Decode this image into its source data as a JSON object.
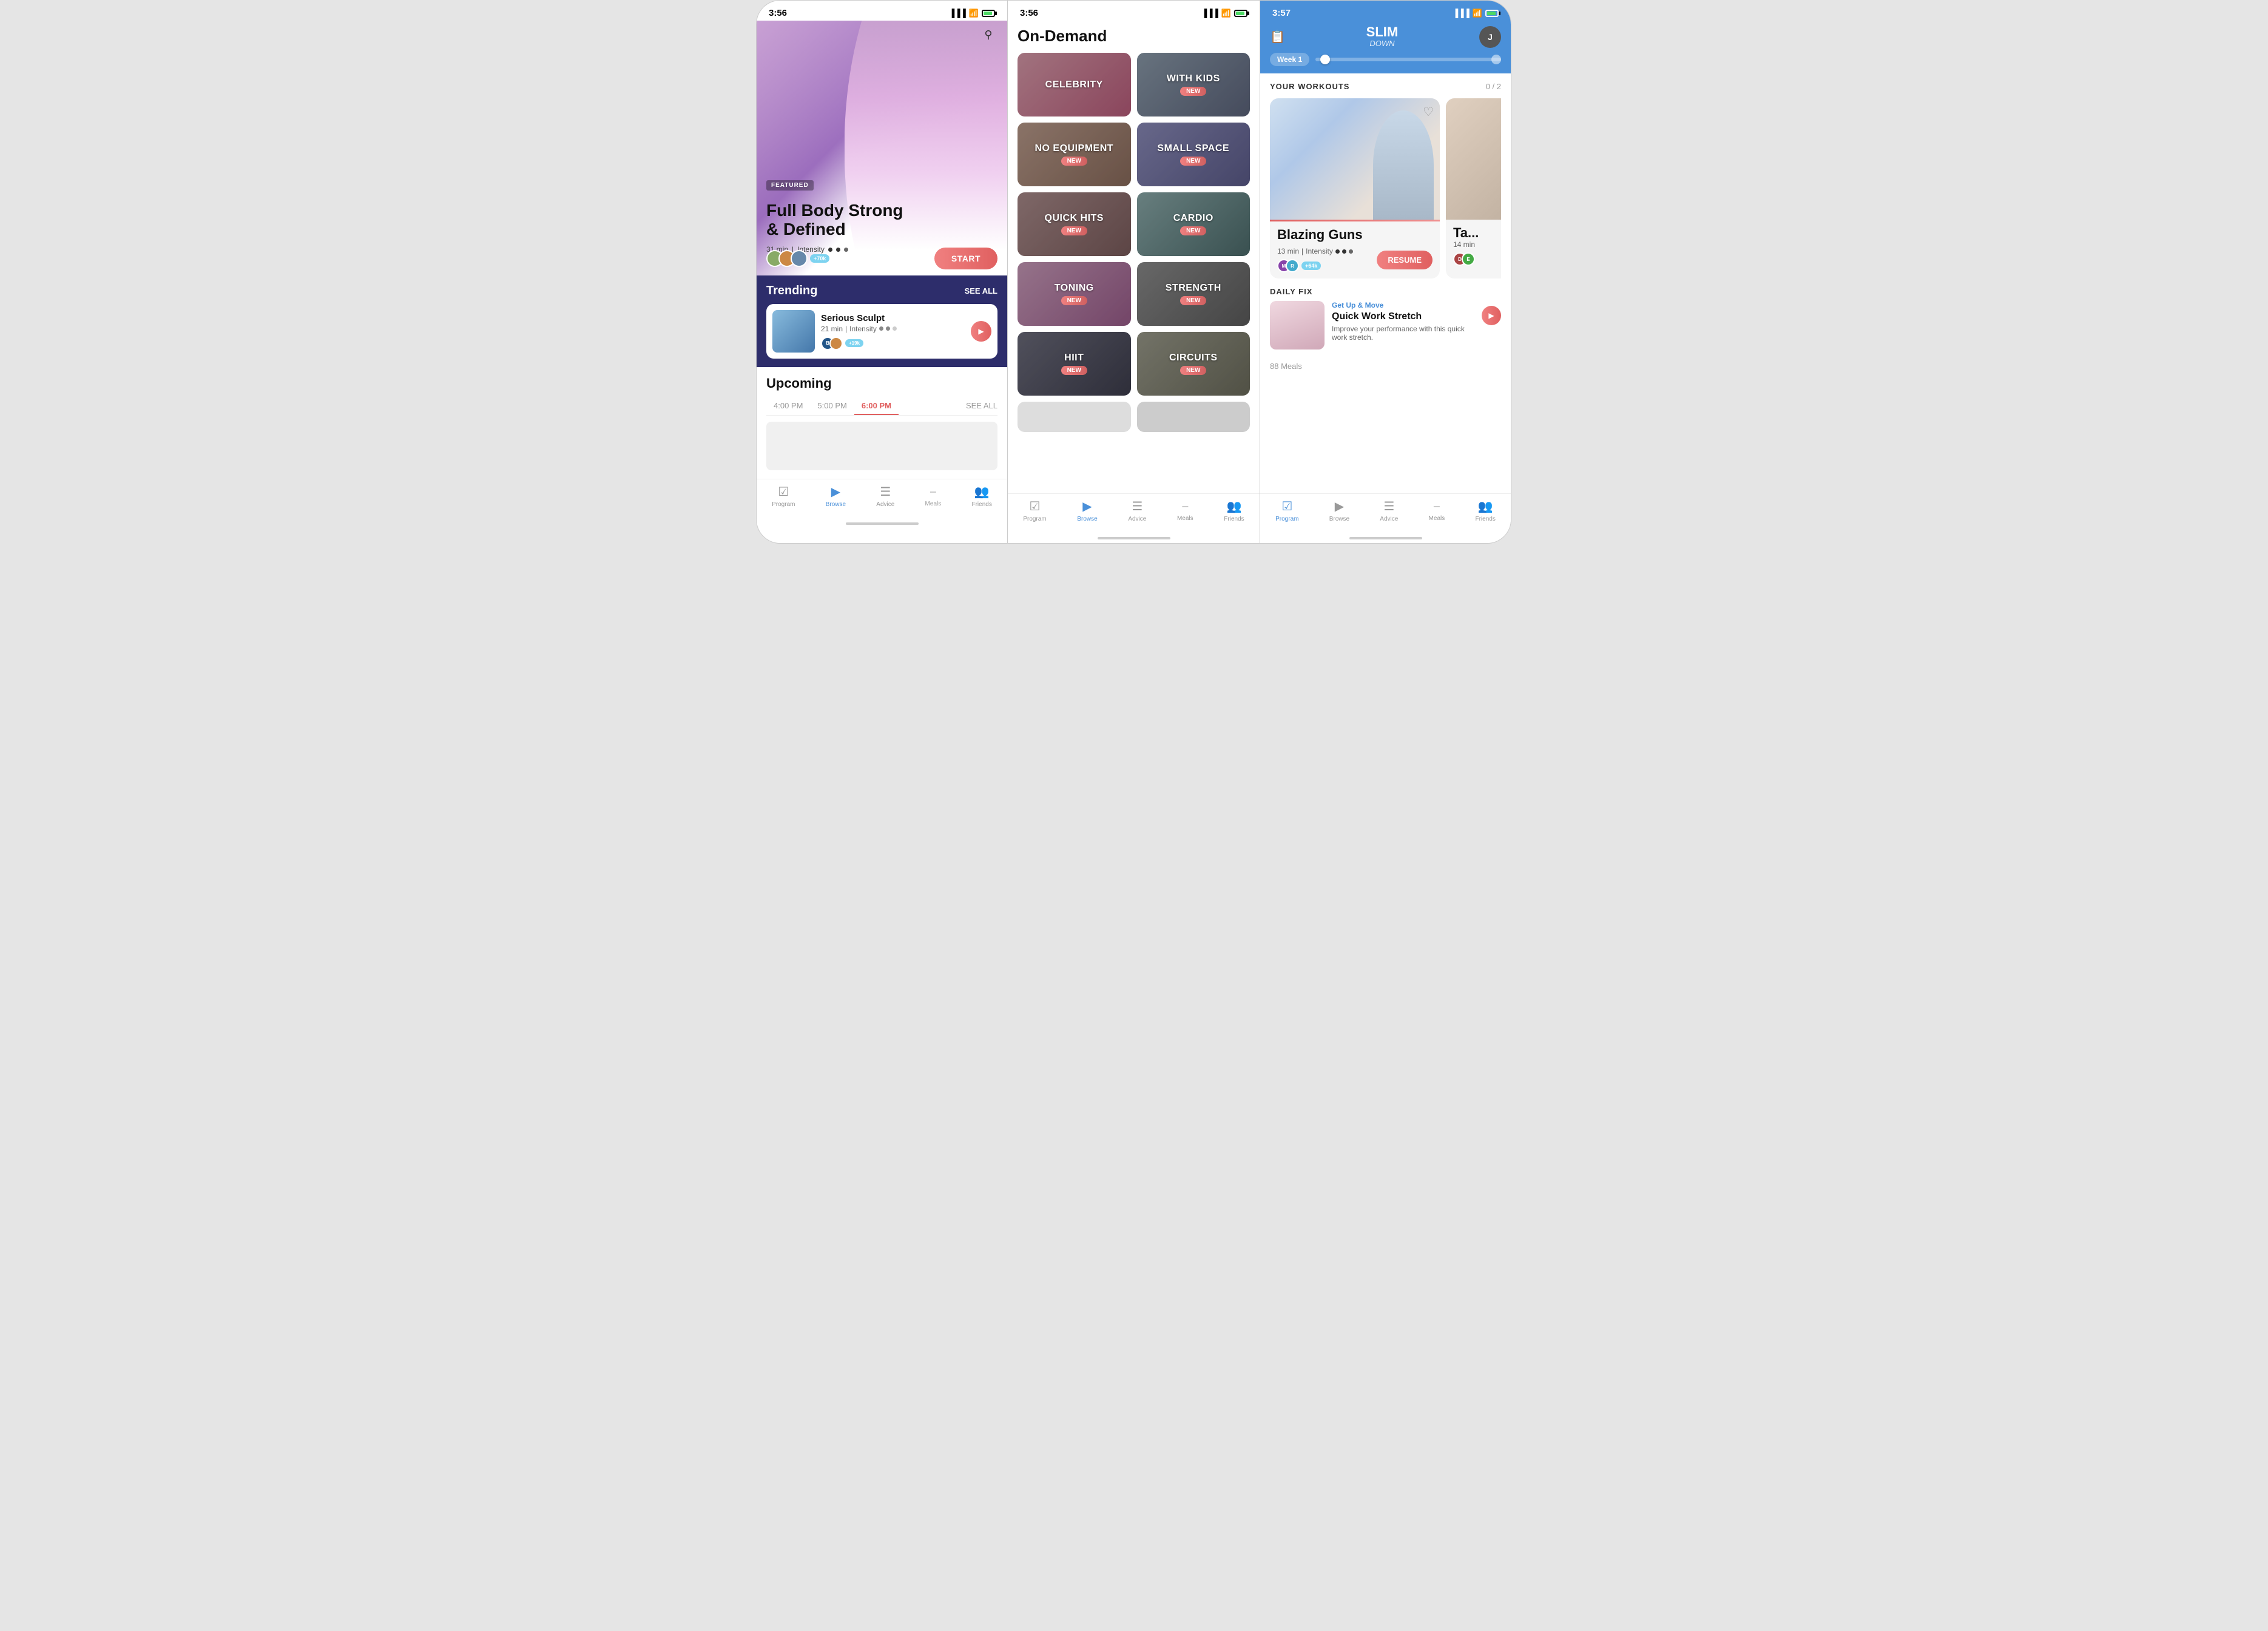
{
  "phone1": {
    "status": {
      "time": "3:56",
      "location": true
    },
    "hero": {
      "badge": "FEATURED",
      "title": "Full Body Strong\n& Defined",
      "duration": "31 min",
      "intensity_label": "Intensity",
      "user_count": "+70k",
      "start_btn": "START"
    },
    "trending": {
      "title": "Trending",
      "see_all": "SEE ALL",
      "card": {
        "name": "Serious Sculpt",
        "duration": "21 min",
        "intensity_label": "Intensity",
        "user_count": "+19k"
      }
    },
    "upcoming": {
      "title": "Upcoming",
      "times": [
        "4:00 PM",
        "5:00 PM",
        "6:00 PM"
      ],
      "active_time": "6:00 PM",
      "see_all": "SEE ALL"
    },
    "nav": [
      {
        "id": "program",
        "label": "Program",
        "icon": "☑"
      },
      {
        "id": "browse",
        "label": "Browse",
        "icon": "▷",
        "active": true
      },
      {
        "id": "advice",
        "label": "Advice",
        "icon": "☰"
      },
      {
        "id": "meals",
        "label": "Meals",
        "icon": "🍴"
      },
      {
        "id": "friends",
        "label": "Friends",
        "icon": "👥"
      }
    ]
  },
  "phone2": {
    "status": {
      "time": "3:56",
      "location": true
    },
    "title": "On-Demand",
    "categories": [
      {
        "id": "celebrity",
        "label": "CELEBRITY",
        "bg": "celebrity",
        "new": false
      },
      {
        "id": "withkids",
        "label": "WITH KIDS",
        "bg": "withkids",
        "new": true
      },
      {
        "id": "noequip",
        "label": "NO EQUIPMENT",
        "bg": "noequip",
        "new": true
      },
      {
        "id": "smallspace",
        "label": "SMALL SPACE",
        "bg": "smallspace",
        "new": true
      },
      {
        "id": "quickhits",
        "label": "QUICK HITS",
        "bg": "quickhits",
        "new": true
      },
      {
        "id": "cardio",
        "label": "CARDIO",
        "bg": "cardio",
        "new": true
      },
      {
        "id": "toning",
        "label": "TONING",
        "bg": "toning",
        "new": true
      },
      {
        "id": "strength",
        "label": "STRENGTH",
        "bg": "strength",
        "new": true
      },
      {
        "id": "hiit",
        "label": "HIIT",
        "bg": "hiit",
        "new": true
      },
      {
        "id": "circuits",
        "label": "CIRCUITS",
        "bg": "circuits",
        "new": true
      }
    ],
    "new_label": "NEW",
    "nav": [
      {
        "id": "program",
        "label": "Program",
        "icon": "☑"
      },
      {
        "id": "browse",
        "label": "Browse",
        "icon": "▷",
        "active": true
      },
      {
        "id": "advice",
        "label": "Advice",
        "icon": "☰"
      },
      {
        "id": "meals",
        "label": "Meals",
        "icon": "🍴"
      },
      {
        "id": "friends",
        "label": "Friends",
        "icon": "👥"
      }
    ]
  },
  "phone3": {
    "status": {
      "time": "3:57",
      "location": true
    },
    "header": {
      "logo_line1": "SLIM",
      "logo_line2": "DOWN",
      "week": "Week 1",
      "avatar_initial": "J"
    },
    "your_workouts": {
      "title": "YOUR WORKOUTS",
      "count": "0 / 2",
      "cards": [
        {
          "title": "Blazing Guns",
          "duration": "13 min",
          "intensity_label": "Intensity",
          "user_count": "+64k",
          "resume_btn": "RESUME"
        },
        {
          "title": "Ta...",
          "duration": "14 min"
        }
      ]
    },
    "daily_fix": {
      "title": "DAILY FIX",
      "category": "Get Up & Move",
      "name": "Quick Work Stretch",
      "description": "Improve your performance with this quick work stretch."
    },
    "meals_section": {
      "count_label": "88 Meals"
    },
    "nav": [
      {
        "id": "program",
        "label": "Program",
        "icon": "☑",
        "active": true
      },
      {
        "id": "browse",
        "label": "Browse",
        "icon": "▷"
      },
      {
        "id": "advice",
        "label": "Advice",
        "icon": "☰"
      },
      {
        "id": "meals",
        "label": "Meals",
        "icon": "🍴"
      },
      {
        "id": "friends",
        "label": "Friends",
        "icon": "👥"
      }
    ]
  }
}
